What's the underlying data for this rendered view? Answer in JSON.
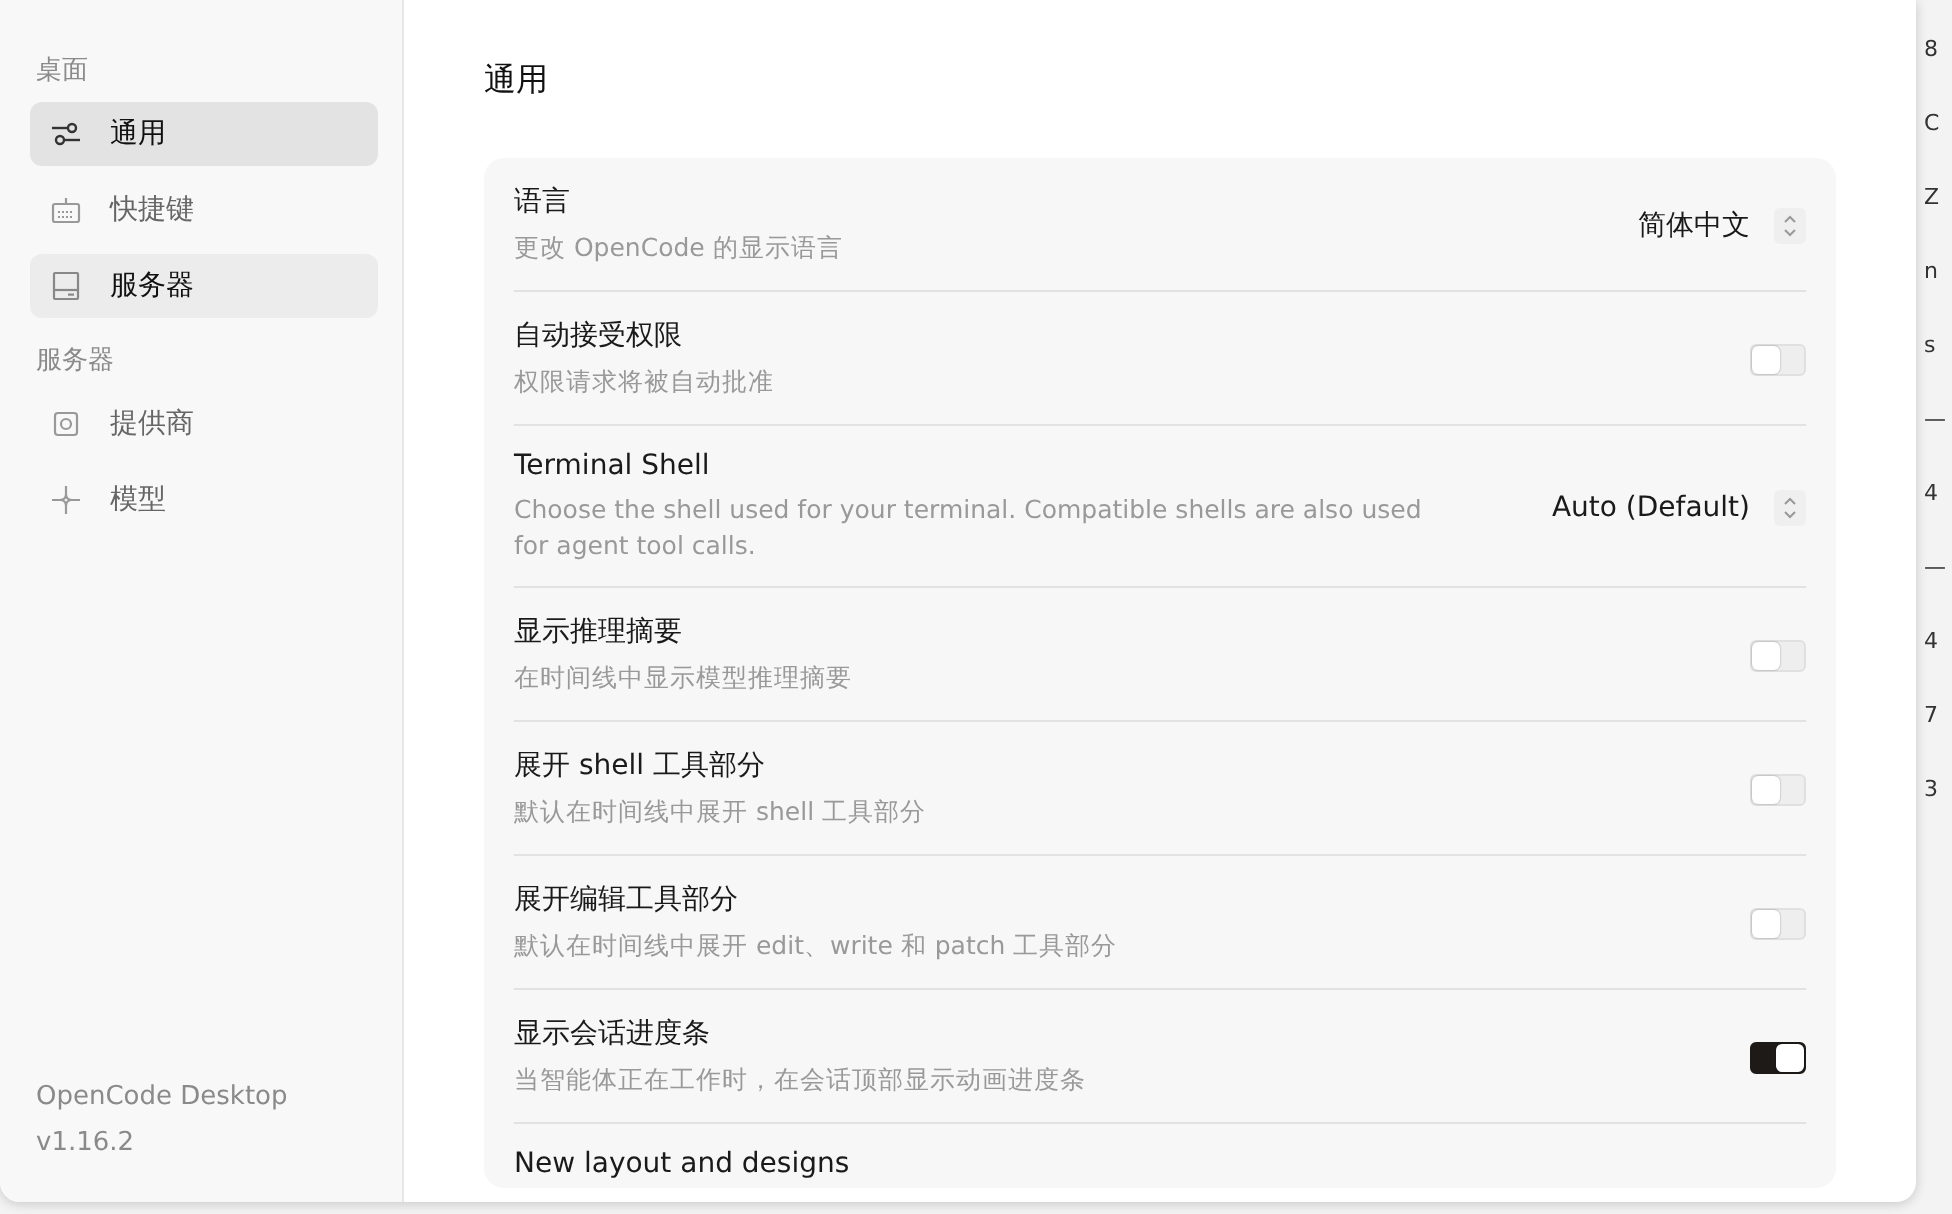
{
  "sidebar": {
    "sections": [
      {
        "heading": "桌面",
        "items": [
          {
            "label": "通用",
            "selected": true,
            "hovered": false
          },
          {
            "label": "快捷键",
            "selected": false,
            "hovered": false
          },
          {
            "label": "服务器",
            "selected": false,
            "hovered": true
          }
        ]
      },
      {
        "heading": "服务器",
        "items": [
          {
            "label": "提供商",
            "selected": false,
            "hovered": false
          },
          {
            "label": "模型",
            "selected": false,
            "hovered": false
          }
        ]
      }
    ],
    "footer": {
      "app_name": "OpenCode Desktop",
      "version": "v1.16.2"
    }
  },
  "main": {
    "title": "通用",
    "settings": [
      {
        "kind": "select",
        "label": "语言",
        "description": "更改 OpenCode 的显示语言",
        "value": "简体中文"
      },
      {
        "kind": "toggle",
        "label": "自动接受权限",
        "description": "权限请求将被自动批准",
        "on": false
      },
      {
        "kind": "select",
        "label": "Terminal Shell",
        "description": "Choose the shell used for your terminal. Compatible shells are also used for agent tool calls.",
        "value": "Auto (Default)"
      },
      {
        "kind": "toggle",
        "label": "显示推理摘要",
        "description": "在时间线中显示模型推理摘要",
        "on": false
      },
      {
        "kind": "toggle",
        "label": "展开 shell 工具部分",
        "description": "默认在时间线中展开 shell 工具部分",
        "on": false
      },
      {
        "kind": "toggle",
        "label": "展开编辑工具部分",
        "description": "默认在时间线中展开 edit、write 和 patch 工具部分",
        "on": false
      },
      {
        "kind": "toggle",
        "label": "显示会话进度条",
        "description": "当智能体正在工作时，在会话顶部显示动画进度条",
        "on": true
      },
      {
        "kind": "heading",
        "label": "New layout and designs"
      }
    ]
  },
  "background_panel": {
    "values": [
      "8",
      "C",
      "Z",
      "n",
      "s",
      "—",
      "4",
      "—",
      "4",
      "7",
      "3"
    ]
  }
}
